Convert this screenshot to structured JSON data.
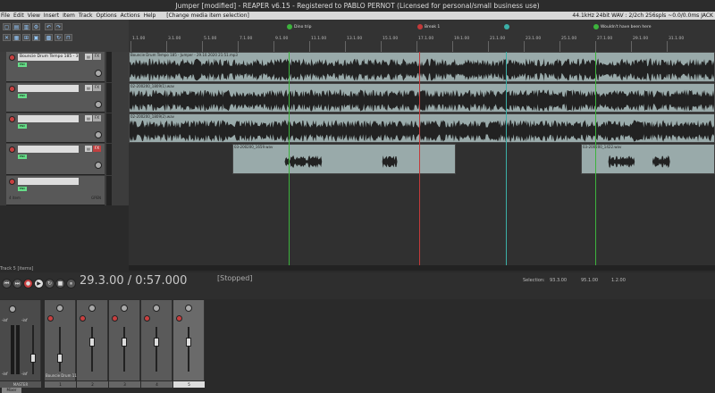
{
  "window": {
    "title": "Jumper [modified] - REAPER v6.15 - Registered to PABLO PERNOT (Licensed for personal/small business use)"
  },
  "menu": {
    "items": [
      "File",
      "Edit",
      "View",
      "Insert",
      "Item",
      "Track",
      "Options",
      "Actions",
      "Help"
    ],
    "status": "[Change media item selection]",
    "right_status": "44.1kHz 24bit WAV : 2/2ch 256spls ~0.0/0.0ms JACK"
  },
  "regions": [
    {
      "label": "Dino trip",
      "color": "#3db33d"
    },
    {
      "label": "Break 1",
      "color": "#c33a3a"
    },
    {
      "label": "",
      "color": "#3bb0a8"
    },
    {
      "label": "Wouldn't have been here",
      "color": "#3db33d"
    }
  ],
  "ruler_ticks": [
    "1.1.00",
    "3.1.00",
    "5.1.00",
    "7.1.00",
    "9.1.00",
    "11.1.00",
    "13.1.00",
    "15.1.00",
    "17.1.00",
    "19.1.00",
    "21.1.00",
    "23.1.00",
    "25.1.00",
    "27.1.00",
    "29.1.00",
    "31.1.00"
  ],
  "tracks": [
    {
      "name": "Bouncie Drum Tempo 185 - 3:1",
      "fx": "FX",
      "sub": "ENV"
    },
    {
      "name": "",
      "fx": "FX",
      "sub": "ENV"
    },
    {
      "name": "",
      "fx": "FX",
      "sub": "ENV"
    },
    {
      "name": "",
      "fx": "FX",
      "sub": "ENV",
      "red": true
    },
    {
      "name": "",
      "fx": "FX",
      "sub": "ENV",
      "label2": "4 item",
      "label3": "GPEN"
    }
  ],
  "items": [
    {
      "label": "Bouncie Drum Tempo 185 - Jumper - 29.10.2020 21:51.mp3"
    },
    {
      "label": "02-200200_1809(1).wav"
    },
    {
      "label": "02-200200_1809(2).wav"
    },
    {
      "label": "03-200200_1659.wav"
    },
    {
      "label": "03-200200_1422.wav"
    }
  ],
  "transport": {
    "time": "29.3.00 / 0:57.000",
    "state": "[Stopped]",
    "selection_label": "Selection:",
    "sel_start": "93.3.00",
    "sel_end": "95.1.00",
    "sel_len": "1.2.00",
    "track_label": "Track 5 [items]"
  },
  "mixer": {
    "master_label": "MASTER",
    "strips": [
      {
        "num": "1",
        "name": "Bouncie Drum 11"
      },
      {
        "num": "2",
        "name": ""
      },
      {
        "num": "3",
        "name": ""
      },
      {
        "num": "4",
        "name": ""
      },
      {
        "num": "5",
        "name": ""
      }
    ],
    "master_vals": [
      "-inf",
      "-inf"
    ],
    "master_bottom": [
      "-inf",
      "-inf"
    ],
    "tab": "Mixer"
  },
  "colors": {
    "record": "#c84040",
    "green_marker": "#3db33d",
    "red_marker": "#c33a3a"
  }
}
